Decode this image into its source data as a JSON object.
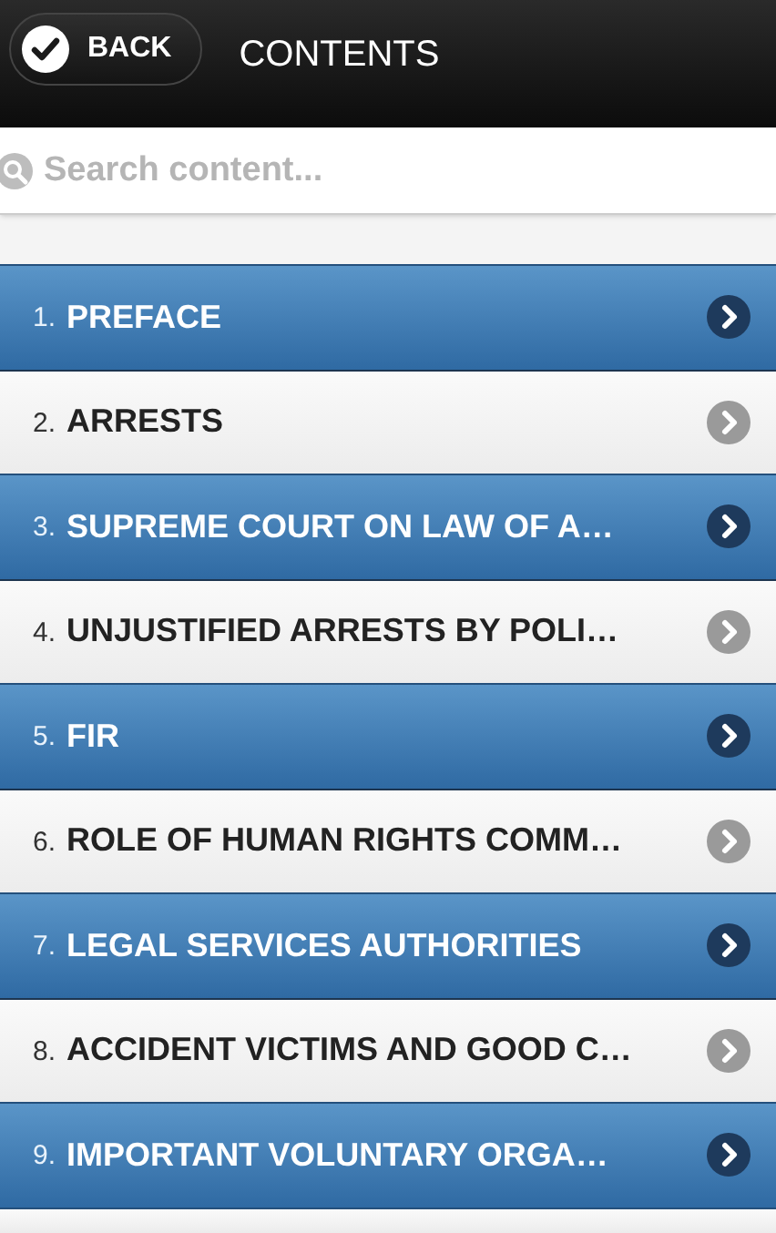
{
  "header": {
    "back_button": "BACK",
    "title": "CONTENTS"
  },
  "search": {
    "placeholder": "Search content..."
  },
  "items": [
    {
      "number": "1.",
      "title": "PREFACE",
      "highlighted": true
    },
    {
      "number": "2.",
      "title": "ARRESTS",
      "highlighted": false
    },
    {
      "number": "3.",
      "title": "SUPREME COURT ON LAW OF A…",
      "highlighted": true
    },
    {
      "number": "4.",
      "title": "UNJUSTIFIED ARRESTS BY POLI…",
      "highlighted": false
    },
    {
      "number": "5.",
      "title": "FIR",
      "highlighted": true
    },
    {
      "number": "6.",
      "title": "ROLE OF HUMAN RIGHTS COMM…",
      "highlighted": false
    },
    {
      "number": "7.",
      "title": "LEGAL SERVICES AUTHORITIES",
      "highlighted": true
    },
    {
      "number": "8.",
      "title": "ACCIDENT VICTIMS AND GOOD C…",
      "highlighted": false
    },
    {
      "number": "9.",
      "title": "IMPORTANT VOLUNTARY ORGA…",
      "highlighted": true
    }
  ]
}
